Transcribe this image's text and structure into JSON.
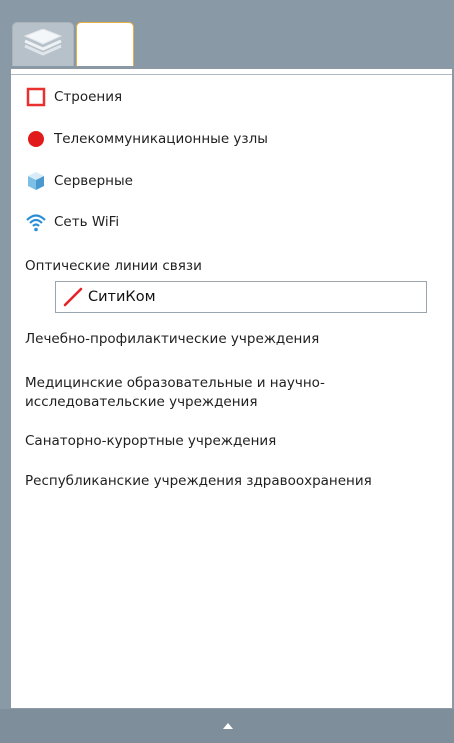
{
  "tabs": [
    {
      "icon": "layers-icon",
      "label": ""
    },
    {
      "label": ""
    }
  ],
  "legend": {
    "items": [
      {
        "label": "Строения",
        "icon": "outlined-square-icon",
        "color": "#e8312f"
      },
      {
        "label": "Телекоммуникационные узлы",
        "icon": "red-dot-icon",
        "color": "#e11b1b"
      },
      {
        "label": "Серверные",
        "icon": "server-cube-icon",
        "color": "#5aa6d6"
      },
      {
        "label": "Сеть WiFi",
        "icon": "wifi-icon",
        "color": "#2a8ed6"
      }
    ],
    "optical_lines": {
      "label": "Оптические линии связи",
      "provider": {
        "label": "СитиКом",
        "icon": "red-line-icon",
        "color": "#e4242a"
      }
    },
    "categories": [
      "Лечебно-профилактические учреждения",
      "Медицинские образовательные и научно-\nисследовательские учреждения",
      "Санаторно-курортные учреждения",
      "Республиканские учреждения здравоохранения"
    ]
  },
  "footer": {
    "toggle_icon": "chevron-up-icon"
  }
}
